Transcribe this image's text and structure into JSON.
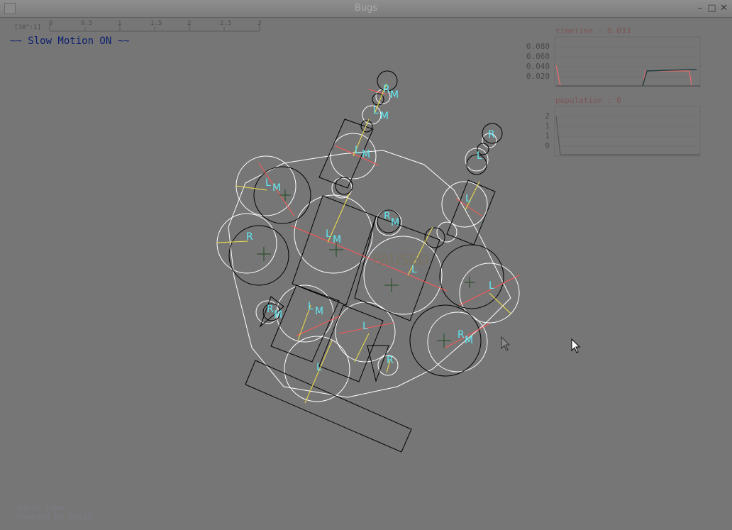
{
  "window": {
    "title": "Bugs",
    "controls": [
      "–",
      "□",
      "✕"
    ]
  },
  "hud": {
    "slow_motion": "~~ Slow Motion ON ~~",
    "ruler_label": "[10^:1]",
    "ruler_ticks": [
      "0",
      "0.5",
      "1",
      "1.5",
      "2",
      "2.5",
      "3"
    ],
    "paused_text": "PAUSED"
  },
  "timeline_panel": {
    "title": "timeline : 0.033",
    "y_ticks": [
      "0.080",
      "0.060",
      "0.040",
      "0.020"
    ]
  },
  "population_panel": {
    "title": "population : 0",
    "y_ticks": [
      "2",
      "1",
      "1",
      "0"
    ]
  },
  "footer": {
    "line1": "Salut Luma",
    "line2": "Powered by Box2D"
  },
  "bug_labels": {
    "r": "R",
    "l": "L",
    "m": "M"
  },
  "colors": {
    "background": "#767676",
    "wireframe_white": "#ffffff",
    "wireframe_black": "#000000",
    "label_cyan": "#5fe8f0",
    "slow_motion_text": "#0b1f6e",
    "stat_title": "#7d5555"
  }
}
